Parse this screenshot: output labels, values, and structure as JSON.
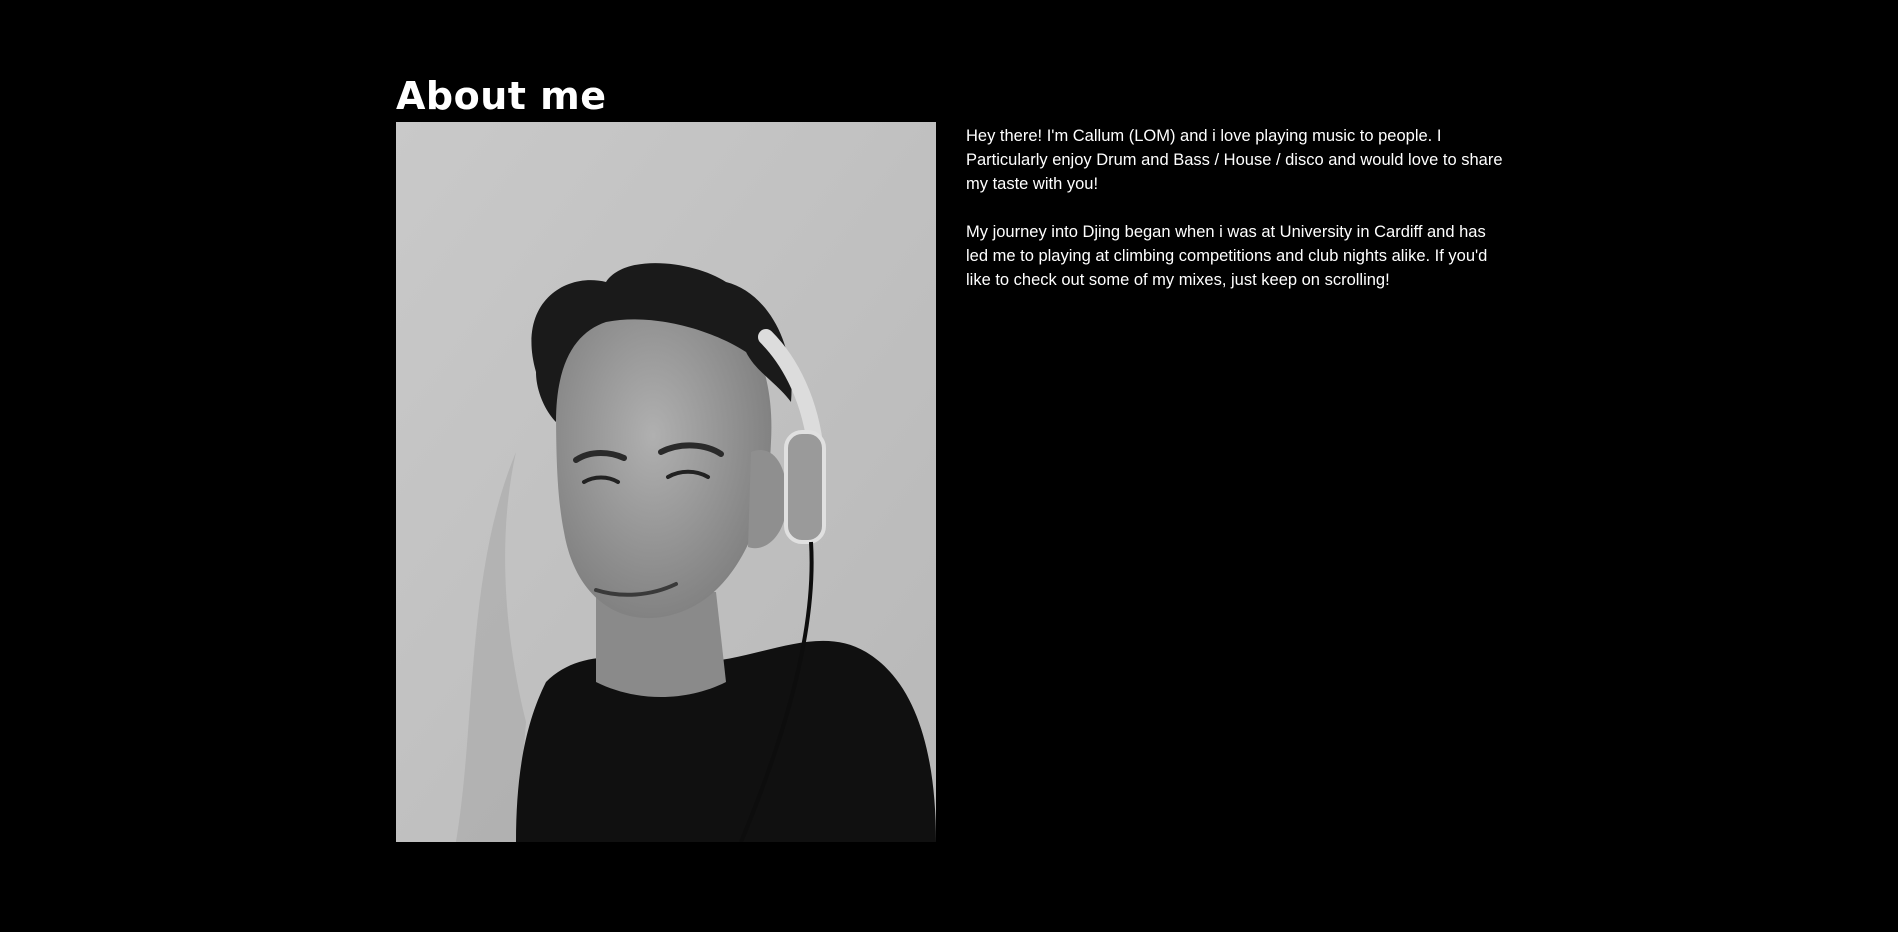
{
  "about": {
    "title": "About me",
    "photo_alt": "Black and white portrait of Callum wearing headphones",
    "paragraphs": [
      "Hey there! I'm Callum (LOM) and i love playing music to people. I Particularly enjoy Drum and Bass / House / disco and would love to share my taste with you!",
      "My journey into Djing began when i was at University in Cardiff and has led me to playing at climbing competitions and club nights alike. If you'd like to check out some of my mixes, just keep on scrolling!"
    ]
  },
  "colors": {
    "background": "#000000",
    "text": "#ffffff",
    "photo_wall": "#c3c3c3"
  }
}
